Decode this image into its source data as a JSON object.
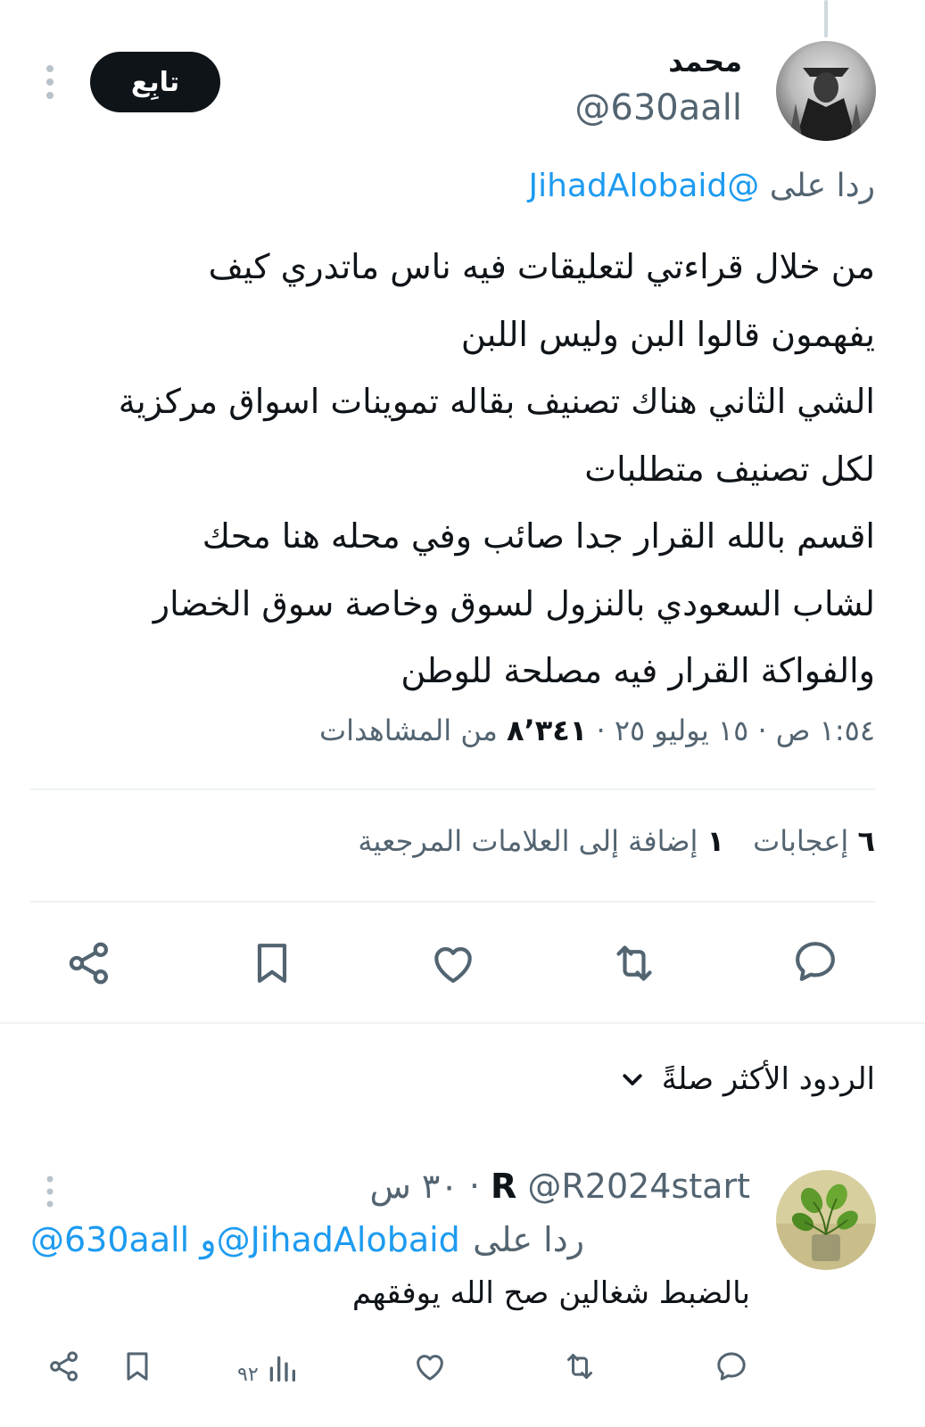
{
  "tweet": {
    "author": {
      "name": "محمد",
      "handle": "@630aall"
    },
    "follow_label": "تابِع",
    "reply_to": {
      "prefix": "ردا على",
      "mention": "@JihadAlobaid"
    },
    "lines": [
      "من خلال قراءتي لتعليقات فيه ناس ماتدري كيف",
      "يفهمون قالوا البن وليس اللبن",
      "الشي الثاني هناك تصنيف بقاله تموينات اسواق مركزية",
      "لكل تصنيف متطلبات",
      "اقسم بالله القرار جدا صائب وفي محله هنا محك",
      "لشاب السعودي بالنزول لسوق وخاصة سوق الخضار",
      "والفواكة القرار فيه مصلحة للوطن"
    ],
    "meta": {
      "timestamp": "١:٥٤ ص · ١٥ يوليو ٢٥ ·",
      "views_count": "٨٬٣٤١",
      "views_label": "من المشاهدات"
    },
    "stats": {
      "likes_count": "٦",
      "likes_label": "إعجابات",
      "bookmarks_count": "١",
      "bookmarks_label": "إضافة إلى العلامات المرجعية"
    },
    "actions": {
      "reply_icon": "reply-icon",
      "retweet_icon": "retweet-icon",
      "like_icon": "heart-icon",
      "bookmark_icon": "bookmark-icon",
      "share_icon": "share-icon"
    }
  },
  "replies_sort": {
    "label": "الردود الأكثر صلةً"
  },
  "reply": {
    "name": "R",
    "handle": "@R2024start",
    "time": "· ٣٠ س",
    "reply_to_prefix": "ردا على",
    "reply_to_mentions": "@630aall و@JihadAlobaid",
    "text": "بالضبط شغالين صح الله يوفقهم",
    "views": "٩٢"
  },
  "colors": {
    "text": "#0f1419",
    "secondary": "#536471",
    "accent": "#1d9bf0",
    "divider": "#eff3f4",
    "follow_bg": "#0f1419"
  }
}
